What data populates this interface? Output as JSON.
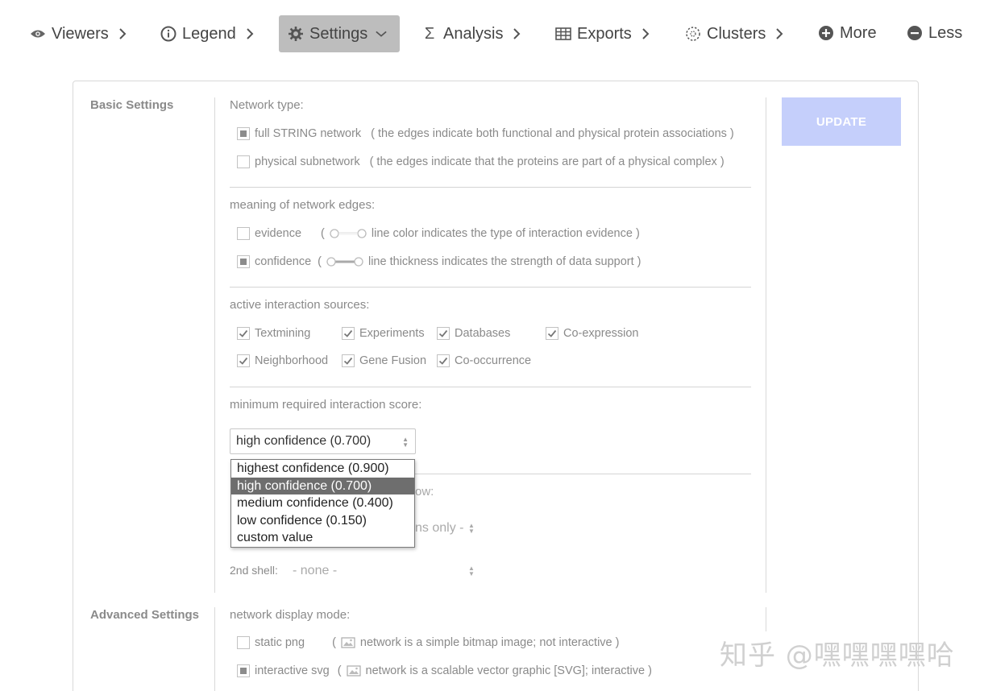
{
  "nav": {
    "viewers": "Viewers",
    "legend": "Legend",
    "settings": "Settings",
    "analysis": "Analysis",
    "exports": "Exports",
    "clusters": "Clusters",
    "more": "More",
    "less": "Less"
  },
  "basic": {
    "title": "Basic Settings",
    "network_type_label": "Network type:",
    "full_network": "full STRING network",
    "full_network_desc": "( the edges indicate both functional and physical protein associations )",
    "physical_network": "physical subnetwork",
    "physical_network_desc": "( the edges indicate that the proteins are part of a physical complex )",
    "edges_label": "meaning of network edges:",
    "evidence": "evidence",
    "evidence_open": "(",
    "evidence_desc": "line color indicates the type of interaction evidence )",
    "confidence": "confidence",
    "confidence_open": "(",
    "confidence_desc": "line thickness indicates the strength of data support )",
    "sources_label": "active interaction sources:",
    "sources": [
      "Textmining",
      "Experiments",
      "Databases",
      "Co-expression",
      "Neighborhood",
      "Gene Fusion",
      "Co-occurrence"
    ],
    "score_label": "minimum required interaction score:",
    "score_value": "high confidence (0.700)",
    "score_options": [
      "highest confidence (0.900)",
      "high confidence (0.700)",
      "medium confidence (0.400)",
      "low confidence (0.150)",
      "custom value"
    ],
    "partial_ow": "ow:",
    "partial_ns_only": "ns only -",
    "second_shell_label": "2nd shell:",
    "second_shell_value": "- none -"
  },
  "update_label": "UPDATE",
  "advanced": {
    "title": "Advanced Settings",
    "display_mode_label": "network display mode:",
    "static_png": "static png",
    "static_png_desc": "network is a simple bitmap image; not interactive )",
    "interactive_svg": "interactive svg",
    "interactive_svg_desc": "network is a scalable vector graphic [SVG]; interactive )",
    "paren": "("
  },
  "watermark": "知乎 @嘿嘿嘿嘿哈",
  "colors": {
    "update_bg": "#c5cffb",
    "selected_option_bg": "#6e6e6e",
    "nav_active_bg": "#bdbdbd"
  }
}
